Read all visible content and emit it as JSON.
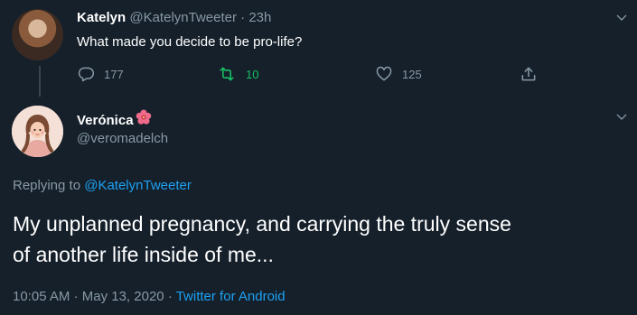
{
  "parent_tweet": {
    "name": "Katelyn",
    "handle": "@KatelynTweeter",
    "separator": "·",
    "time": "23h",
    "text": "What made you decide to be pro-life?",
    "reply_count": "177",
    "retweet_count": "10",
    "like_count": "125"
  },
  "reply_tweet": {
    "name": "Verónica",
    "handle": "@veromadelch",
    "replying_prefix": "Replying to",
    "replying_to": "@KatelynTweeter",
    "text_line1": "My unplanned pregnancy, and carrying the truly sense",
    "text_line2": "of another life inside of me...",
    "time": "10:05 AM",
    "date": "May 13, 2020",
    "separator": "·",
    "source": "Twitter for Android"
  },
  "colors": {
    "background": "#15202b",
    "muted": "#8899a6",
    "link": "#1da1f2",
    "retweet_active": "#17bf63"
  },
  "icons": {
    "reply": "reply-icon",
    "retweet": "retweet-icon",
    "like": "heart-icon",
    "share": "share-icon",
    "more": "chevron-down-icon",
    "flower": "hibiscus-emoji-icon"
  }
}
